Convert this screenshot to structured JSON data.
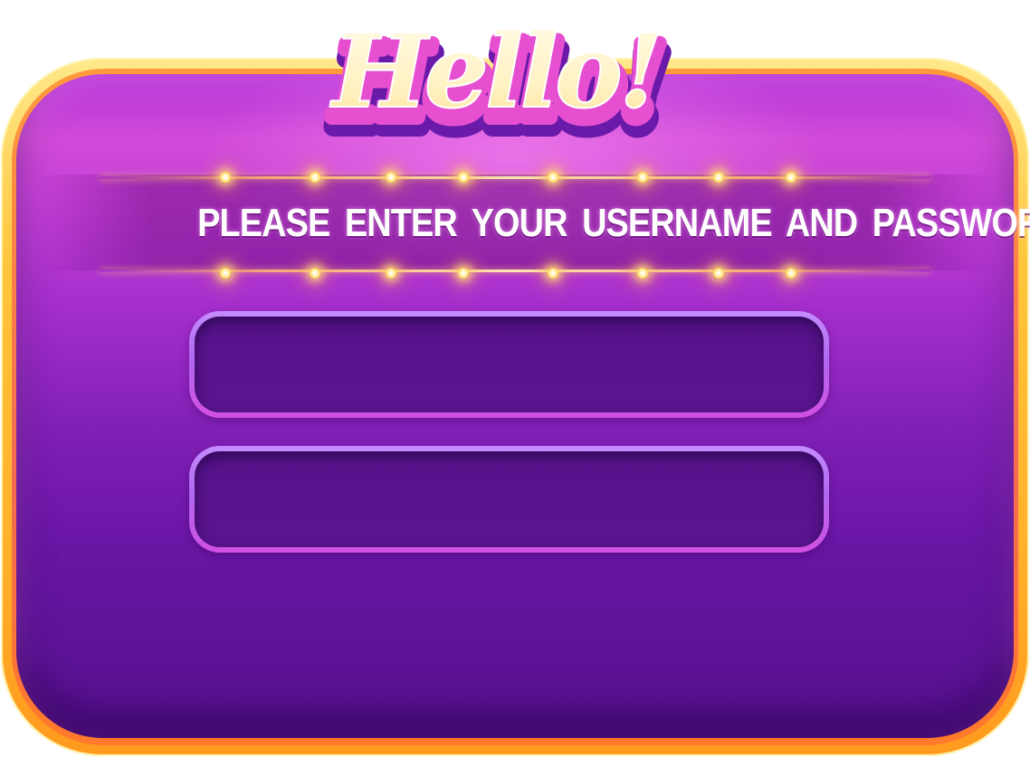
{
  "title": {
    "text": "Hello!"
  },
  "instruction": {
    "text": "PLEASE  ENTER  YOUR USERNAME AND PASSWORD"
  },
  "form": {
    "username": {
      "value": "",
      "placeholder": ""
    },
    "password": {
      "value": "",
      "placeholder": ""
    }
  },
  "colors": {
    "frame_gold": "#ffc53a",
    "panel_purple": "#7e1fb4",
    "field_fill": "#56128a",
    "field_border": "#c58cff",
    "title_cream": "#fff6cf",
    "title_pink": "#e64fcf",
    "light_yellow": "#ffd34a"
  },
  "decorations": {
    "marquee_light_icons": "marquee-light-icon"
  }
}
